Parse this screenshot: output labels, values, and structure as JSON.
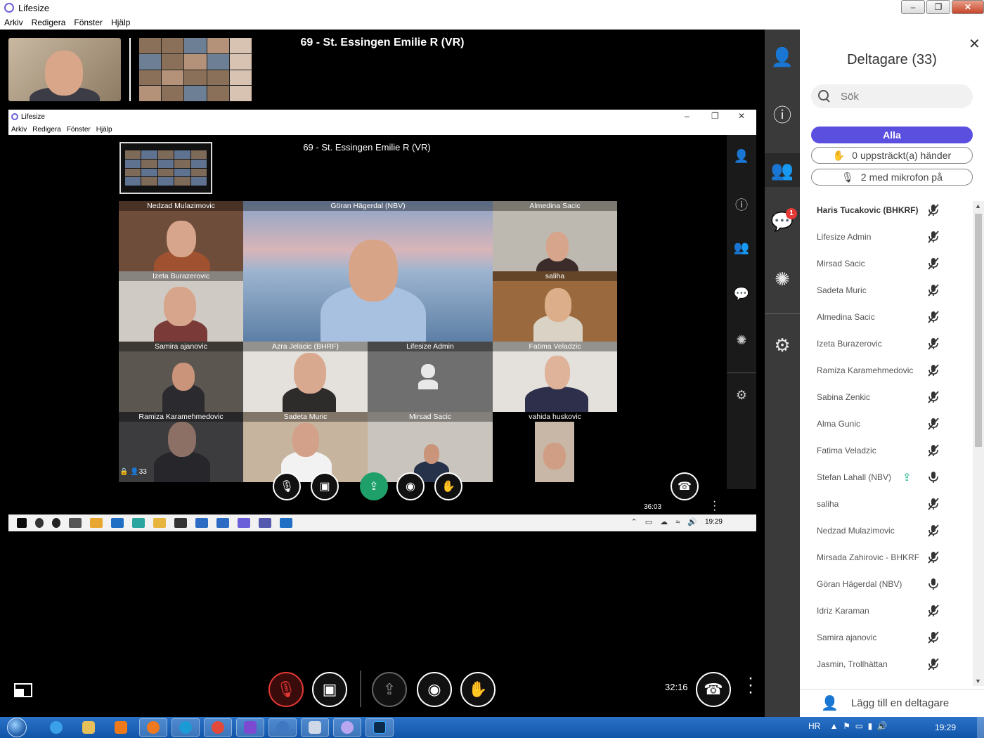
{
  "window": {
    "title": "Lifesize",
    "menu": [
      "Arkiv",
      "Redigera",
      "Fönster",
      "Hjälp"
    ]
  },
  "call": {
    "title": "69 - St. Essingen Emilie R (VR)",
    "time": "32:16"
  },
  "shared": {
    "window_title": "Lifesize",
    "menu": [
      "Arkiv",
      "Redigera",
      "Fönster",
      "Hjälp"
    ],
    "call_title": "69 - St. Essingen Emilie R (VR)",
    "time": "36:03",
    "participant_count": "33",
    "taskbar_clock": "19:29",
    "tiles": [
      {
        "name": "Nedzad Mulazimovic"
      },
      {
        "name": "Göran Hägerdal (NBV)"
      },
      {
        "name": "Almedina Sacic"
      },
      {
        "name": "Izeta Burazerovic"
      },
      {
        "name": "saliha"
      },
      {
        "name": "Samira ajanovic"
      },
      {
        "name": "Azra Jelacic (BHRF)"
      },
      {
        "name": "Lifesize Admin"
      },
      {
        "name": "Fatima Veladzic"
      },
      {
        "name": "Ramiza Karamehmedovic"
      },
      {
        "name": "Sadeta Muric"
      },
      {
        "name": "Mirsad Sacic"
      },
      {
        "name": "vahida huskovic"
      }
    ]
  },
  "panel": {
    "title": "Deltagare (33)",
    "search_placeholder": "Sök",
    "filter_all": "Alla",
    "filter_hands": "0 uppsträckt(a) händer",
    "filter_mic": "2 med mikrofon på",
    "add_participant": "Lägg till en deltagare",
    "participants": [
      {
        "name": "Haris Tucakovic (BHKRF)",
        "mic": "muted",
        "bold": true
      },
      {
        "name": "Lifesize Admin",
        "mic": "muted"
      },
      {
        "name": "Mirsad Sacic",
        "mic": "muted"
      },
      {
        "name": "Sadeta Muric",
        "mic": "muted"
      },
      {
        "name": "Almedina Sacic",
        "mic": "muted"
      },
      {
        "name": "Izeta Burazerovic",
        "mic": "muted"
      },
      {
        "name": "Ramiza Karamehmedovic",
        "mic": "muted"
      },
      {
        "name": "Sabina Zenkic",
        "mic": "muted"
      },
      {
        "name": "Alma Gunic",
        "mic": "muted"
      },
      {
        "name": "Fatima Veladzic",
        "mic": "muted"
      },
      {
        "name": "Stefan Lahall (NBV)",
        "mic": "on",
        "presenting": true
      },
      {
        "name": "saliha",
        "mic": "muted"
      },
      {
        "name": "Nedzad Mulazimovic",
        "mic": "muted"
      },
      {
        "name": "Mirsada Zahirovic - BHKRF",
        "mic": "muted"
      },
      {
        "name": "Göran Hägerdal (NBV)",
        "mic": "on"
      },
      {
        "name": "Idriz Karaman",
        "mic": "muted"
      },
      {
        "name": "Samira ajanovic",
        "mic": "muted"
      },
      {
        "name": "Jasmin, Trollhättan",
        "mic": "muted"
      }
    ]
  },
  "rail": {
    "chat_badge": "1"
  },
  "taskbar": {
    "lang": "HR",
    "clock": "19:29"
  },
  "colors": {
    "accent": "#5b4fe0",
    "hangup_red": "#e53935",
    "share_green": "#1fa06b"
  }
}
